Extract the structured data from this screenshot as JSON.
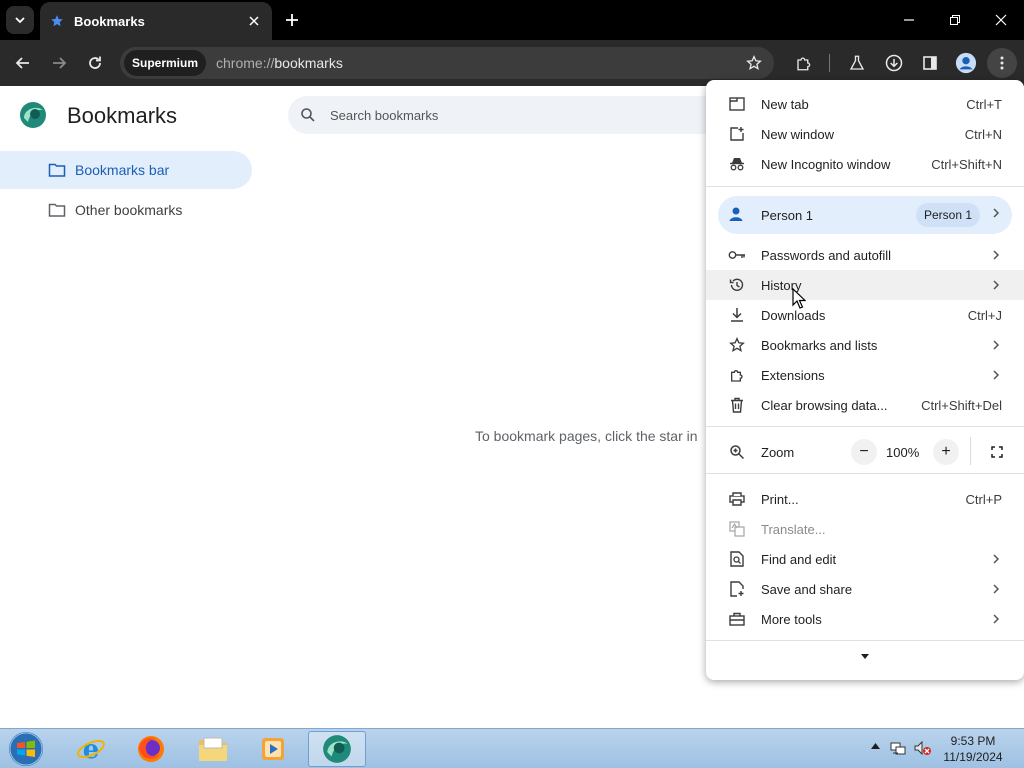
{
  "browser": {
    "tab": {
      "title": "Bookmarks"
    },
    "omnibox": {
      "site_chip": "Supermium",
      "url_scheme": "chrome://",
      "url_path": "bookmarks"
    }
  },
  "page": {
    "title": "Bookmarks",
    "search_placeholder": "Search bookmarks",
    "sidebar": [
      {
        "label": "Bookmarks bar",
        "active": true
      },
      {
        "label": "Other bookmarks",
        "active": false
      }
    ],
    "empty_message": "To bookmark pages, click the star in"
  },
  "menu": {
    "items_top": [
      {
        "label": "New tab",
        "shortcut": "Ctrl+T",
        "icon": "new-tab-icon"
      },
      {
        "label": "New window",
        "shortcut": "Ctrl+N",
        "icon": "new-window-icon"
      },
      {
        "label": "New Incognito window",
        "shortcut": "Ctrl+Shift+N",
        "icon": "incognito-icon"
      }
    ],
    "person": {
      "label": "Person 1",
      "chip": "Person 1"
    },
    "items_mid": [
      {
        "label": "Passwords and autofill",
        "icon": "key-icon"
      },
      {
        "label": "History",
        "icon": "history-icon"
      },
      {
        "label": "Downloads",
        "shortcut": "Ctrl+J",
        "icon": "download-icon"
      },
      {
        "label": "Bookmarks and lists",
        "icon": "star-icon"
      },
      {
        "label": "Extensions",
        "icon": "puzzle-icon"
      },
      {
        "label": "Clear browsing data...",
        "shortcut": "Ctrl+Shift+Del",
        "icon": "trash-icon"
      }
    ],
    "zoom": {
      "label": "Zoom",
      "value": "100%",
      "minus": "−",
      "plus": "+"
    },
    "items_bottom": [
      {
        "label": "Print...",
        "shortcut": "Ctrl+P",
        "icon": "print-icon"
      },
      {
        "label": "Translate...",
        "icon": "translate-icon",
        "disabled": true
      },
      {
        "label": "Find and edit",
        "icon": "find-icon"
      },
      {
        "label": "Save and share",
        "icon": "save-share-icon"
      },
      {
        "label": "More tools",
        "icon": "toolbox-icon"
      }
    ]
  },
  "taskbar": {
    "clock_time": "9:53 PM",
    "clock_date": "11/19/2024"
  },
  "colors": {
    "accent": "#1a5fb4",
    "active_bg": "#e2eefc",
    "chrome_dark": "#2a2a2a",
    "title_bar": "#000000"
  }
}
